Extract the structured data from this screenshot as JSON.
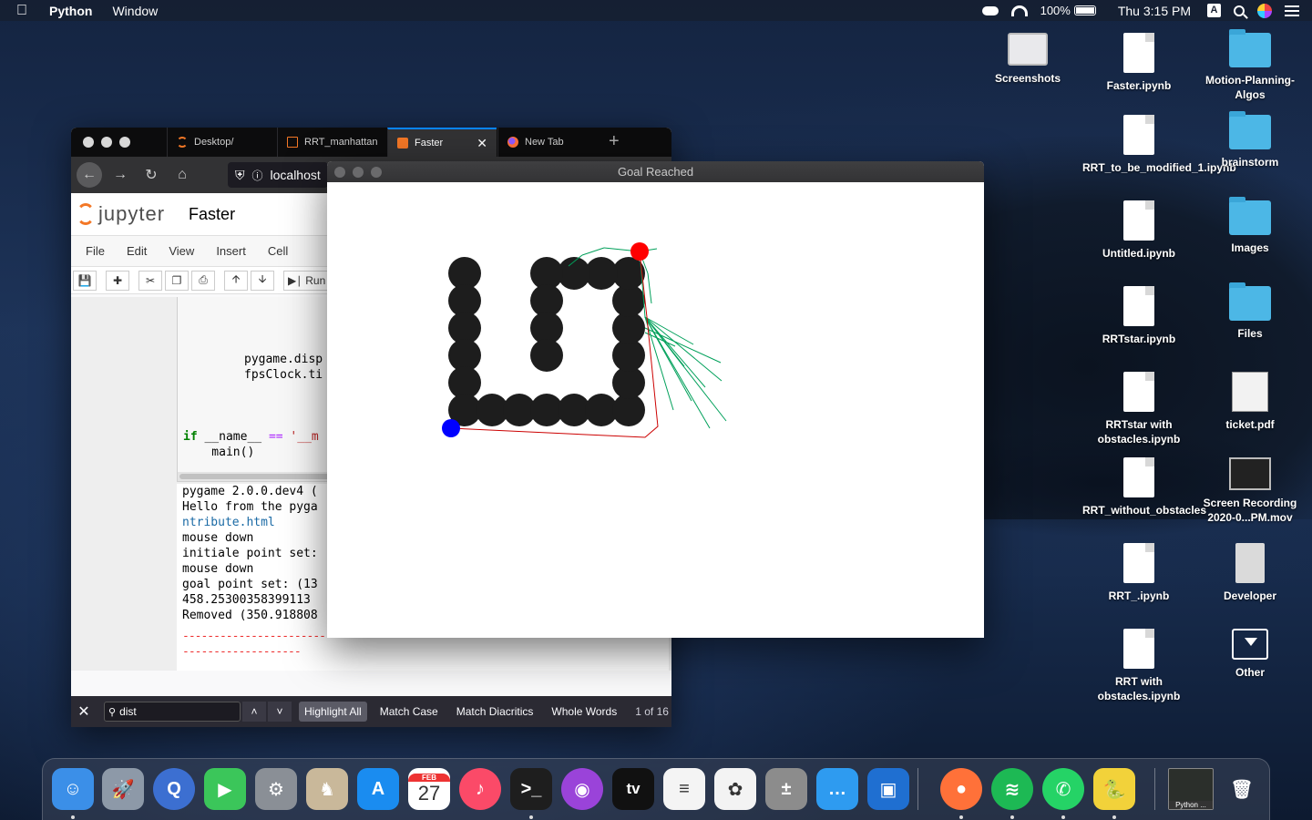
{
  "menubar": {
    "app_name": "Python",
    "menus": [
      "Window"
    ],
    "battery": "100%",
    "clock": "Thu 3:15 PM",
    "input_source": "A"
  },
  "browser": {
    "tabs": [
      {
        "label": "Desktop/",
        "icon": "jupyter-icon"
      },
      {
        "label": "RRT_manhattan",
        "icon": "notebook-doc-icon"
      },
      {
        "label": "Faster",
        "icon": "notebook-book-icon",
        "active": true
      },
      {
        "label": "New Tab",
        "icon": "firefox-icon"
      }
    ],
    "url": "localhost",
    "jupyter": {
      "logo_text": "jupyter",
      "notebook_title": "Faster",
      "menu": [
        "File",
        "Edit",
        "View",
        "Insert",
        "Cell"
      ],
      "run_label": "Run"
    },
    "code": {
      "line1": "pygame.disp",
      "line2": "fpsClock.ti",
      "if_kw": "if",
      "name_var": " __name__ ",
      "eq_op": "==",
      "main_str": " '__m",
      "main_call": "    main()"
    },
    "output": {
      "lines": [
        "pygame 2.0.0.dev4 (",
        "Hello from the pyga",
        "ntribute.html",
        "mouse down",
        "initiale point set:",
        "mouse down",
        "goal point set: (13",
        "458.25300358399113",
        "Removed (350.918808"
      ],
      "link_line_index": 2,
      "separator": "---------------------------------------------------------------------",
      "separator2": "-------------------"
    },
    "findbar": {
      "query": "dist",
      "options": [
        "Highlight All",
        "Match Case",
        "Match Diacritics",
        "Whole Words"
      ],
      "count": "1 of 16"
    }
  },
  "pygame_window": {
    "title": "Goal Reached",
    "colors": {
      "obstacle": "#1d1d1d",
      "start": "#0000ff",
      "goal": "#ff0000",
      "tree": "#00a05a",
      "path": "#cc0000"
    }
  },
  "desktop_icons": [
    {
      "label": "Screenshots",
      "type": "screenshots-folder-icon"
    },
    {
      "label": "Faster.ipynb",
      "type": "document-icon"
    },
    {
      "label": "Motion-Planning-Algos",
      "type": "folder-icon"
    },
    {
      "label": "RRT_to_be_modified_1.ipynb",
      "type": "document-icon"
    },
    {
      "label": "brainstorm",
      "type": "folder-icon"
    },
    {
      "label": "Untitled.ipynb",
      "type": "document-icon"
    },
    {
      "label": "Images",
      "type": "folder-icon"
    },
    {
      "label": "RRTstar.ipynb",
      "type": "document-icon"
    },
    {
      "label": "Files",
      "type": "folder-icon"
    },
    {
      "label": "RRTstar with obstacles.ipynb",
      "type": "document-icon"
    },
    {
      "label": "ticket.pdf",
      "type": "pdf-icon"
    },
    {
      "label": "RRT_without_obstacles",
      "type": "document-icon"
    },
    {
      "label": "Screen Recording 2020-0...PM.mov",
      "type": "movie-icon"
    },
    {
      "label": "RRT_.ipynb",
      "type": "document-icon"
    },
    {
      "label": "Developer",
      "type": "developer-icon"
    },
    {
      "label": "RRT with obstacles.ipynb",
      "type": "document-icon"
    },
    {
      "label": "Other",
      "type": "other-icon"
    }
  ],
  "dock": {
    "apps": [
      "finder",
      "launchpad",
      "quicktime",
      "facetime",
      "system-preferences",
      "chess",
      "app-store",
      "calendar",
      "music",
      "terminal",
      "podcasts",
      "apple-tv",
      "reminders",
      "photos",
      "calculator",
      "messages",
      "virtualbox",
      "firefox",
      "spotify",
      "whatsapp",
      "python-launcher",
      "python-window",
      "trash"
    ],
    "calendar_month": "FEB",
    "calendar_day": "27",
    "tv_label": "tv",
    "python_label": "Python ..."
  }
}
